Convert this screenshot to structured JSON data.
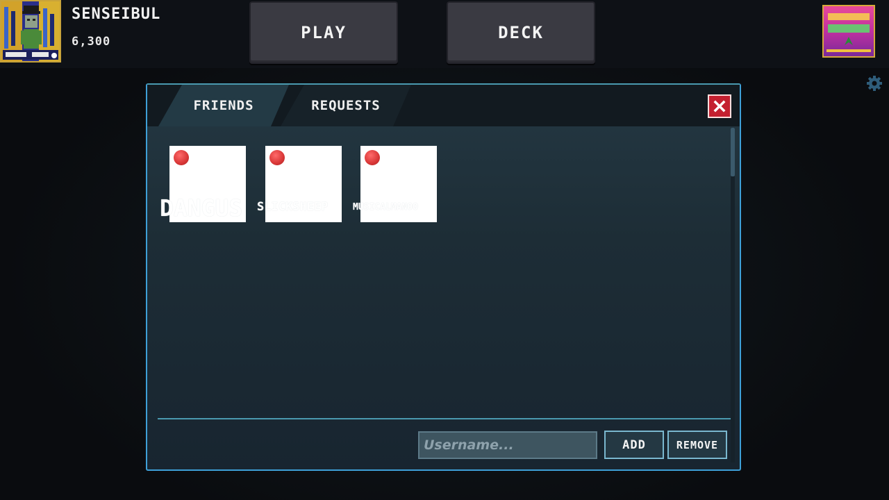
{
  "player": {
    "name": "SENSEIBUL",
    "coins": "6,300"
  },
  "nav": {
    "play_label": "PLAY",
    "deck_label": "DECK"
  },
  "friends_panel": {
    "tabs": [
      {
        "label": "FRIENDS",
        "active": true
      },
      {
        "label": "REQUESTS",
        "active": false
      }
    ],
    "friends": [
      {
        "name": "DANGUS",
        "status": "offline"
      },
      {
        "name": "SLICKSHEEP",
        "status": "offline"
      },
      {
        "name": "MUSICALMANOO",
        "status": "offline"
      }
    ],
    "username_placeholder": "Username...",
    "add_label": "ADD",
    "remove_label": "REMOVE"
  },
  "icons": {
    "close": "close-icon",
    "settings": "gear-icon",
    "status": "status-dot-icon"
  },
  "colors": {
    "panel_border": "#3ea0d8",
    "status_offline": "#d83636",
    "close_button": "#c42030"
  }
}
